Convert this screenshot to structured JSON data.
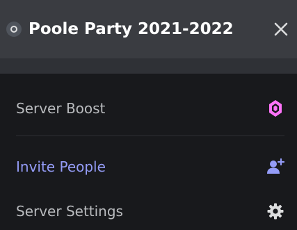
{
  "header": {
    "server_title": "Poole Party 2021-2022",
    "close_icon": "close-icon",
    "server_icon": "server-icon"
  },
  "menu": {
    "items": [
      {
        "label": "Server Boost",
        "icon": "boost-gem-icon",
        "color": "#ff73fa"
      },
      {
        "label": "Invite People",
        "icon": "add-user-icon",
        "color": "#949cf7"
      },
      {
        "label": "Server Settings",
        "icon": "gear-icon",
        "color": "#b9bbbe"
      }
    ]
  },
  "colors": {
    "header_bg": "#3a3c41",
    "menu_bg": "#18191c",
    "text_muted": "#b9bbbe",
    "accent_blurple": "#949cf7",
    "boost_pink": "#ff73fa"
  }
}
